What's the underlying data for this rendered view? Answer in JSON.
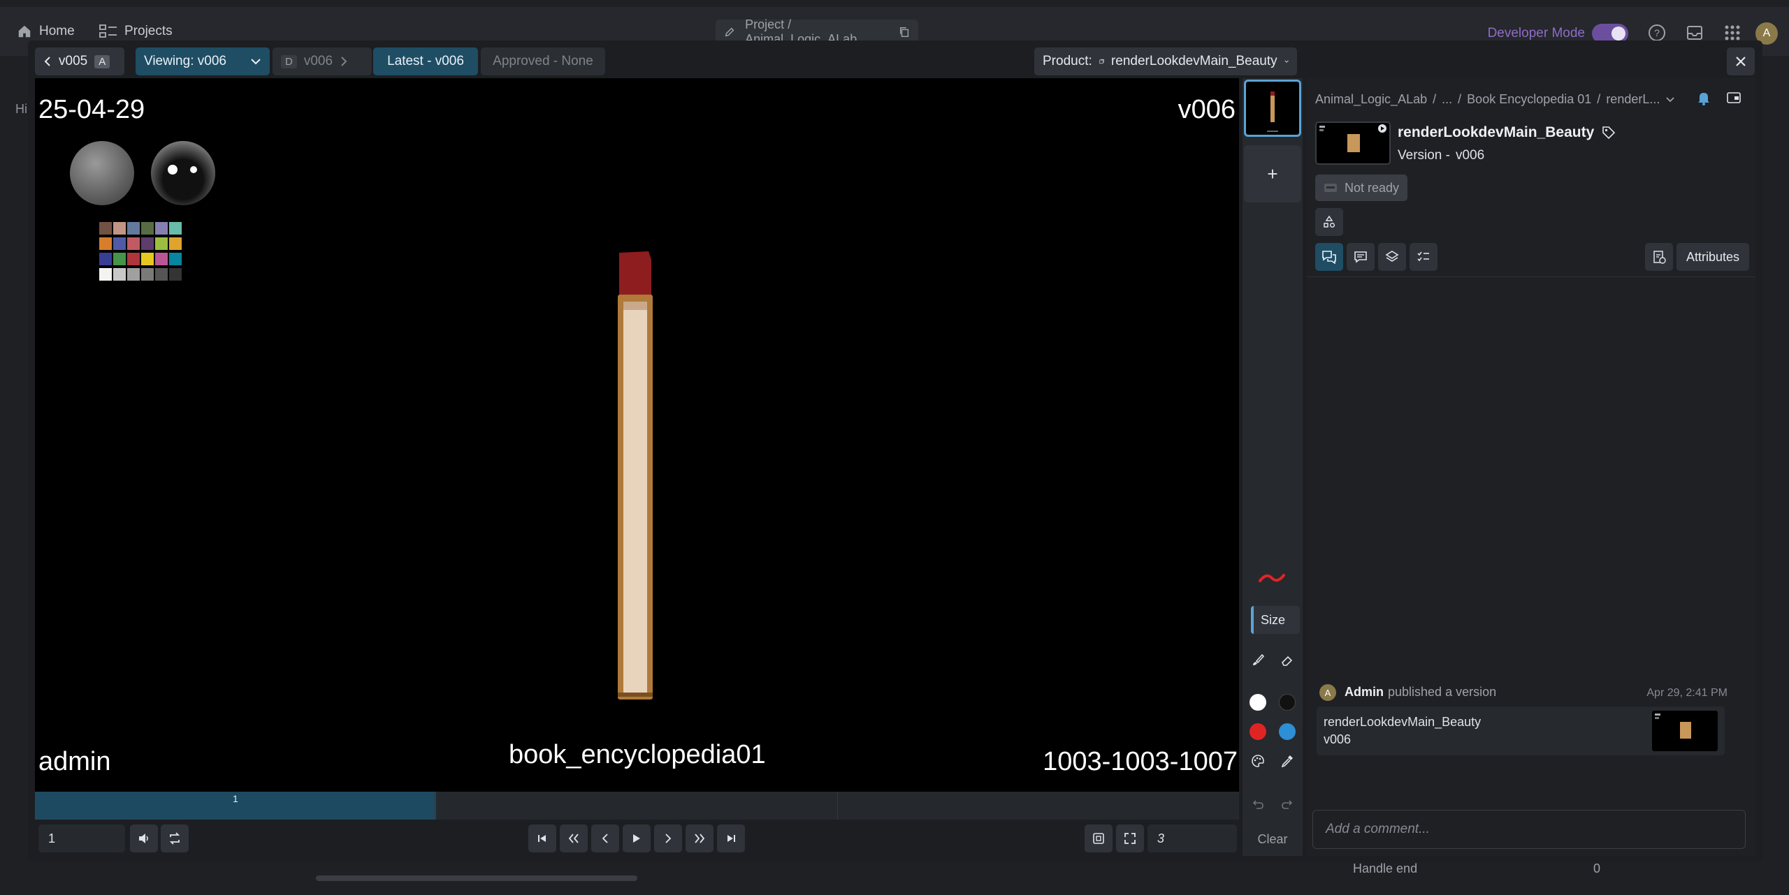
{
  "app": {
    "nav": {
      "home_label": "Home",
      "projects_label": "Projects"
    },
    "project_path": "Project / Animal_Logic_ALab",
    "developer_mode_label": "Developer Mode",
    "avatar_initial": "A"
  },
  "background": {
    "left_fragment_1": "Hi",
    "handle_end_label": "Handle end",
    "handle_end_value": "0"
  },
  "toolbar": {
    "prev_version": "v005",
    "prev_version_badge": "A",
    "viewing_label": "Viewing: v006",
    "diff_badge": "D",
    "diff_version": "v006",
    "latest_label": "Latest - v006",
    "approved_label": "Approved - None",
    "product_prefix": "Product:",
    "product_name": "renderLookdevMain_Beauty"
  },
  "viewport": {
    "date_overlay": "25-04-29",
    "version_overlay": "v006",
    "user_overlay": "admin",
    "asset_overlay": "book_encyclopedia01",
    "frame_overlay": "1003-1003-1007"
  },
  "timeline": {
    "marker_label": "1",
    "progress": 0.333
  },
  "controls": {
    "frame_value": "1",
    "fps_value": "3"
  },
  "annotation_tools": {
    "size_label": "Size",
    "clear_label": "Clear",
    "colors": [
      "#ffffff",
      "#111111",
      "#e02424",
      "#2d8fd6"
    ],
    "brush_color": "#e02424"
  },
  "panel": {
    "breadcrumb": [
      "Animal_Logic_ALab",
      "...",
      "Book Encyclopedia 01",
      "renderL..."
    ],
    "product_name": "renderLookdevMain_Beauty",
    "version_prefix": "Version -",
    "version": "v006",
    "status": "Not ready",
    "attributes_label": "Attributes",
    "activity": {
      "avatar_initial": "A",
      "user": "Admin",
      "action": "published a version",
      "timestamp": "Apr 29, 2:41 PM",
      "card_name": "renderLookdevMain_Beauty",
      "card_version": "v006"
    },
    "comment_placeholder": "Add a comment..."
  },
  "colors": {
    "accent_teal": "#1f4d64",
    "selection_blue": "#5aa3d6",
    "developer_purple": "#8f6cc6"
  }
}
